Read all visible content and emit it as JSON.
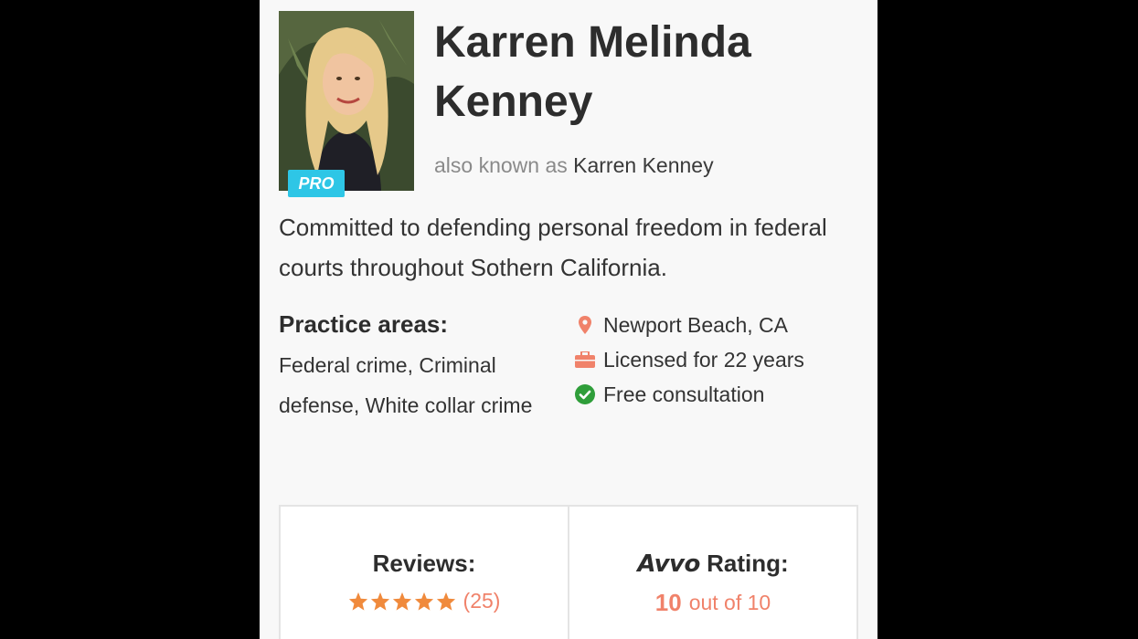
{
  "profile": {
    "name": "Karren Melinda Kenney",
    "pro_badge": "PRO",
    "aka_prefix": "also known as",
    "aka_name": "Karren Kenney",
    "tagline": "Committed to defending personal freedom in federal courts throughout Sothern California."
  },
  "practice": {
    "title": "Practice areas:",
    "areas": "Federal crime, Criminal defense, White collar crime"
  },
  "facts": [
    {
      "icon": "location-pin-icon",
      "text": "Newport Beach, CA"
    },
    {
      "icon": "briefcase-icon",
      "text": "Licensed for 22 years"
    },
    {
      "icon": "check-circle-icon",
      "text": "Free consultation"
    }
  ],
  "reviews": {
    "title": "Reviews:",
    "stars": 5,
    "count": "(25)"
  },
  "rating": {
    "brand": "Avvo",
    "title": "Rating:",
    "value": "10",
    "suffix": "out of 10"
  },
  "colors": {
    "accent": "#f0826a",
    "pro_badge": "#2ec6e6",
    "check": "#2f9e3a",
    "star": "#f08a3c"
  }
}
